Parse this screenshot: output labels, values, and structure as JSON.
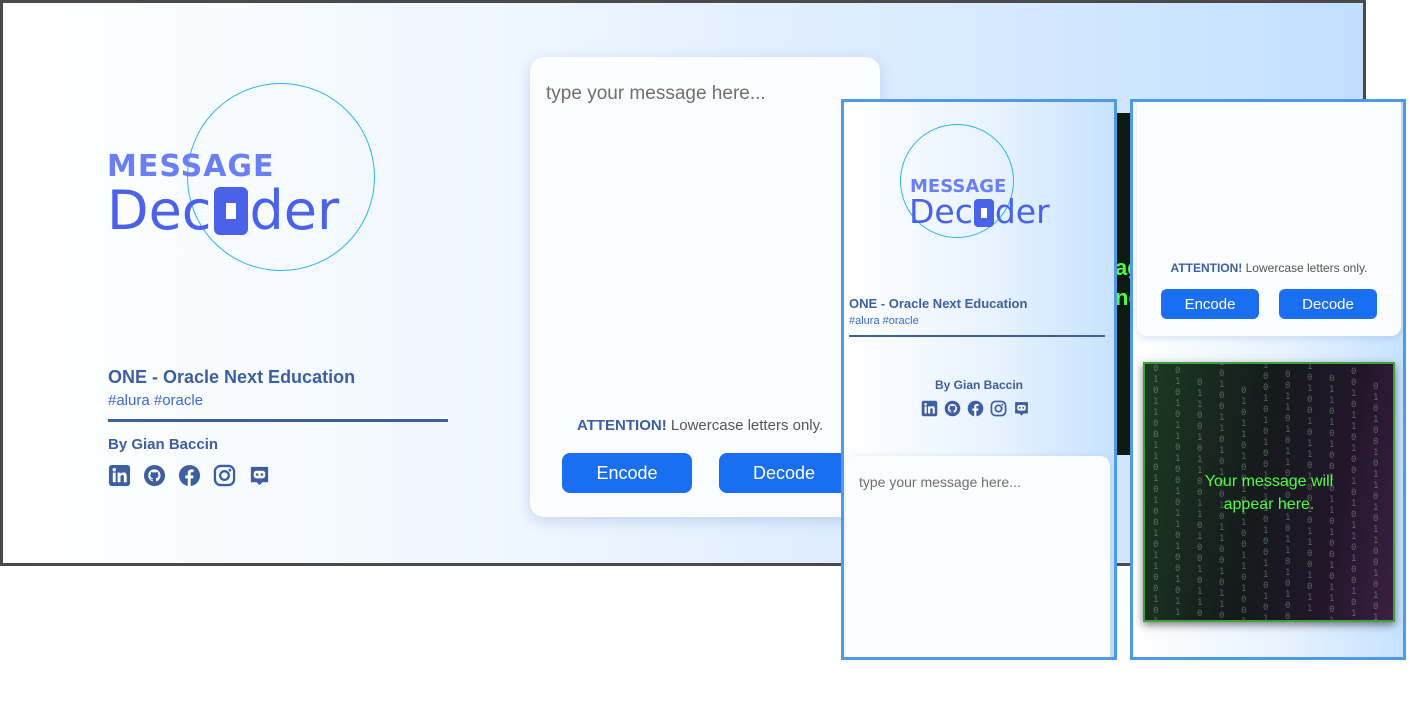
{
  "brand": {
    "logo_top": "MESSAGE",
    "logo_bottom_left": "Dec",
    "logo_bottom_right": "der"
  },
  "org": {
    "title": "ONE - Oracle Next Education",
    "tags": "#alura #oracle"
  },
  "author": {
    "label": "By Gian Baccin"
  },
  "socials": [
    {
      "name": "linkedin-icon"
    },
    {
      "name": "github-icon"
    },
    {
      "name": "facebook-icon"
    },
    {
      "name": "instagram-icon"
    },
    {
      "name": "discord-icon"
    }
  ],
  "editor": {
    "placeholder": "type your message here...",
    "attention_strong": "ATTENTION!",
    "attention_text": " Lowercase letters only."
  },
  "actions": {
    "encode_label": "Encode",
    "decode_label": "Decode"
  },
  "output": {
    "line1": "Your message will",
    "line2": "appear here."
  },
  "colors": {
    "accent": "#1a6ff0",
    "brand_blue": "#4a62e8",
    "text_blue": "#3d5fa0",
    "matrix_green": "#4cff40"
  }
}
